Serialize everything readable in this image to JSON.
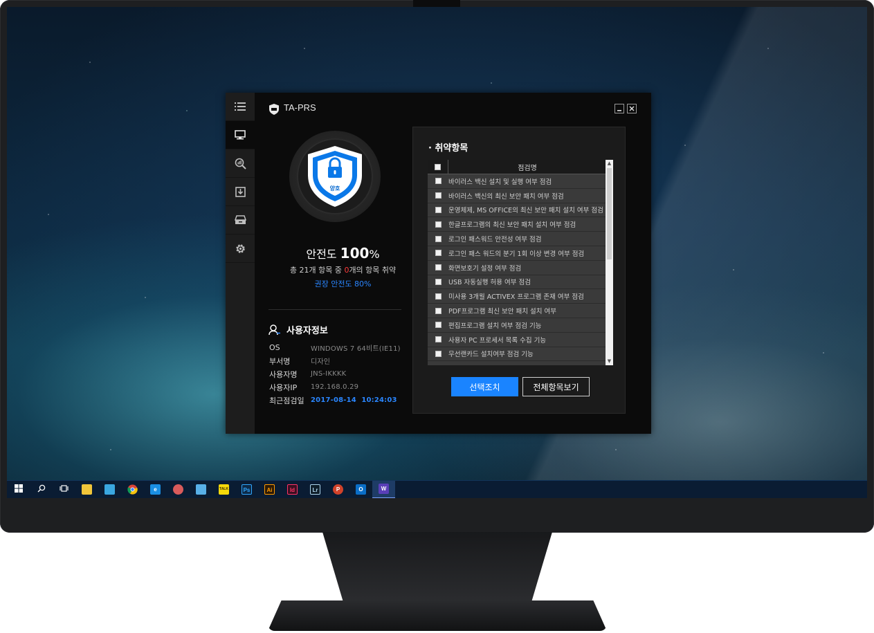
{
  "app": {
    "title": "TA-PRS",
    "shield_status": "양호"
  },
  "safety": {
    "label": "안전도",
    "value": "100",
    "unit": "%",
    "summary_prefix": "총 21개 항목 중 ",
    "summary_zero": "0",
    "summary_suffix": "개의 항목 취약",
    "recommended": "권장 안전도 80%"
  },
  "user": {
    "heading": "사용자정보",
    "rows": [
      {
        "key": "OS",
        "value": "WINDOWS 7 64비트(IE11)"
      },
      {
        "key": "부서명",
        "value": "디자인"
      },
      {
        "key": "사용자명",
        "value": "JNS-IKKKK"
      },
      {
        "key": "사용자IP",
        "value": "192.168.0.29"
      },
      {
        "key": "최근점검일",
        "value": "2017-08-14  10:24:03"
      }
    ]
  },
  "vuln": {
    "title": "· 취약항목",
    "column_header": "점검명",
    "items": [
      "바이러스 백신 설치 및 실행 여부 점검",
      "바이러스 백신의 최신 보안 패치 여부 점검",
      "운영체제, MS OFFICE의 최신 보안 패치 설치 여부 점검",
      "한글프로그램의 최신 보안 패치 설치 여부 점검",
      "로그인 패스워드 안전성 여부 점검",
      "로그인 패스 워드의 분기 1회 이상 변경 여부 점검",
      "화면보호기 설정 여부 점검",
      "USB 자동실행 허용 여부 점검",
      "미사용 3개월 ACTIVEX 프로그램 존재 여부 점검",
      "PDF프로그램 최신 보안 패치 설치 여부",
      "편집프로그램 설치 여부 점검 기능",
      "사용자 PC 프로세서 목록 수집 기능",
      "무선랜카드 설치여부 점검 기능"
    ],
    "action_button": "선택조치",
    "view_all_button": "전체항목보기"
  },
  "taskbar": {
    "icons": [
      {
        "name": "start-icon",
        "glyph": "",
        "color": "#0a1c33"
      },
      {
        "name": "search-icon",
        "glyph": "",
        "color": "#0a1c33"
      },
      {
        "name": "task-view-icon",
        "glyph": "",
        "color": "#0a1c33"
      },
      {
        "name": "file-explorer-icon",
        "glyph": "",
        "color": "#f0c53a"
      },
      {
        "name": "bird-app-icon",
        "glyph": "",
        "color": "#3aa7e0"
      },
      {
        "name": "chrome-icon",
        "glyph": "",
        "color": "#db4437"
      },
      {
        "name": "internet-explorer-icon",
        "glyph": "e",
        "color": "#1a8fe3"
      },
      {
        "name": "paint-icon",
        "glyph": "",
        "color": "#d95b5b"
      },
      {
        "name": "sticky-app-icon",
        "glyph": "",
        "color": "#58b0e8"
      },
      {
        "name": "kakaotalk-icon",
        "glyph": "TALK",
        "color": "#f5d90a"
      },
      {
        "name": "photoshop-icon",
        "glyph": "Ps",
        "color": "#0d2a48"
      },
      {
        "name": "illustrator-icon",
        "glyph": "Ai",
        "color": "#2c1a06"
      },
      {
        "name": "indesign-icon",
        "glyph": "Id",
        "color": "#3a0f21"
      },
      {
        "name": "lightroom-icon",
        "glyph": "Lr",
        "color": "#0f1e2a"
      },
      {
        "name": "powerpoint-icon",
        "glyph": "P",
        "color": "#d0422a"
      },
      {
        "name": "outlook-icon",
        "glyph": "O",
        "color": "#0a6ec8"
      },
      {
        "name": "ta-prs-taskbar-icon",
        "glyph": "W",
        "color": "#5a3fb8"
      }
    ]
  },
  "colors": {
    "accent_blue": "#1a84ff",
    "warning_red": "#ff3b3b",
    "recommend_blue": "#2a86ff"
  }
}
